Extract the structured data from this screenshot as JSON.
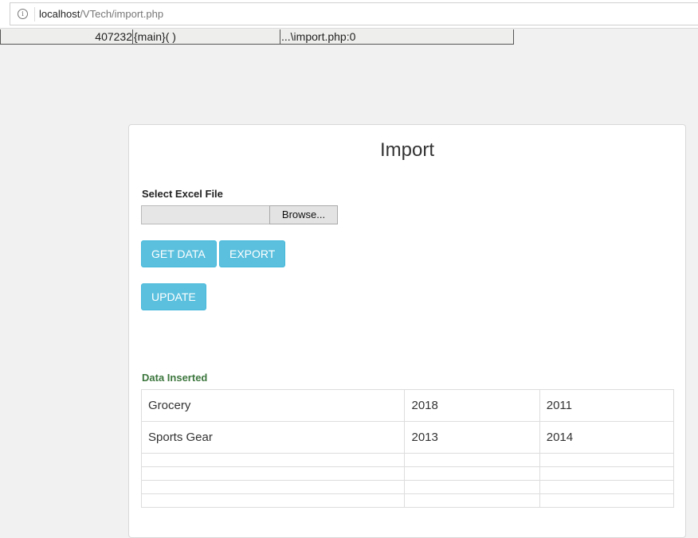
{
  "browser": {
    "url_host": "localhost",
    "url_path": "/VTech/import.php",
    "info_icon_glyph": "i"
  },
  "debug_row": {
    "memory": "407232",
    "function": "{main}( )",
    "location": "...\\import.php:0"
  },
  "panel": {
    "title": "Import",
    "file_label": "Select Excel File",
    "browse_label": "Browse...",
    "buttons": {
      "get_data": "GET DATA",
      "export": "EXPORT",
      "update": "UPDATE"
    },
    "status": "Data Inserted"
  },
  "table": {
    "rows": [
      [
        "Grocery",
        "2018",
        "2011"
      ],
      [
        "Sports Gear",
        "2013",
        "2014"
      ],
      [
        "",
        "",
        ""
      ],
      [
        "",
        "",
        ""
      ],
      [
        "",
        "",
        ""
      ],
      [
        "",
        "",
        ""
      ]
    ]
  },
  "colors": {
    "accent": "#5bc0de",
    "success_text": "#3c763d",
    "page_background": "#f1f1f1"
  }
}
